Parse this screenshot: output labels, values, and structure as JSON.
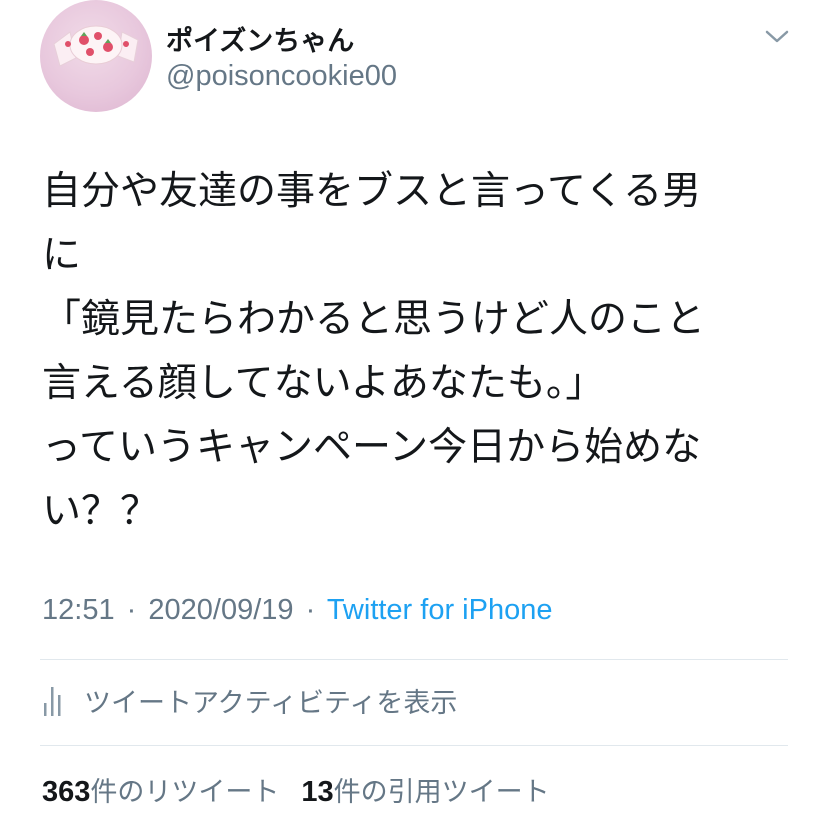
{
  "author": {
    "display_name": "ポイズンちゃん",
    "handle": "@poisoncookie00",
    "avatar_icon": "candy-avatar-icon"
  },
  "tweet": {
    "lines": [
      "自分や友達の事をブスと言ってくる男",
      "に",
      "「鏡見たらわかると思うけど人のこと",
      "言える顔してないよあなたも。」",
      "っていうキャンペーン今日から始めな",
      "い？？"
    ]
  },
  "meta": {
    "time": "12:51",
    "separator": "·",
    "date": "2020/09/19",
    "source": "Twitter for iPhone"
  },
  "activity": {
    "label": "ツイートアクティビティを表示",
    "icon": "bar-chart-icon"
  },
  "stats": {
    "retweets": {
      "count": "363",
      "label": "件のリツイート"
    },
    "quotes": {
      "count": "13",
      "label": "件の引用ツイート"
    }
  },
  "colors": {
    "text_primary": "#14171a",
    "text_secondary": "#657786",
    "link": "#1da1f2",
    "divider": "#e1e8ed"
  }
}
